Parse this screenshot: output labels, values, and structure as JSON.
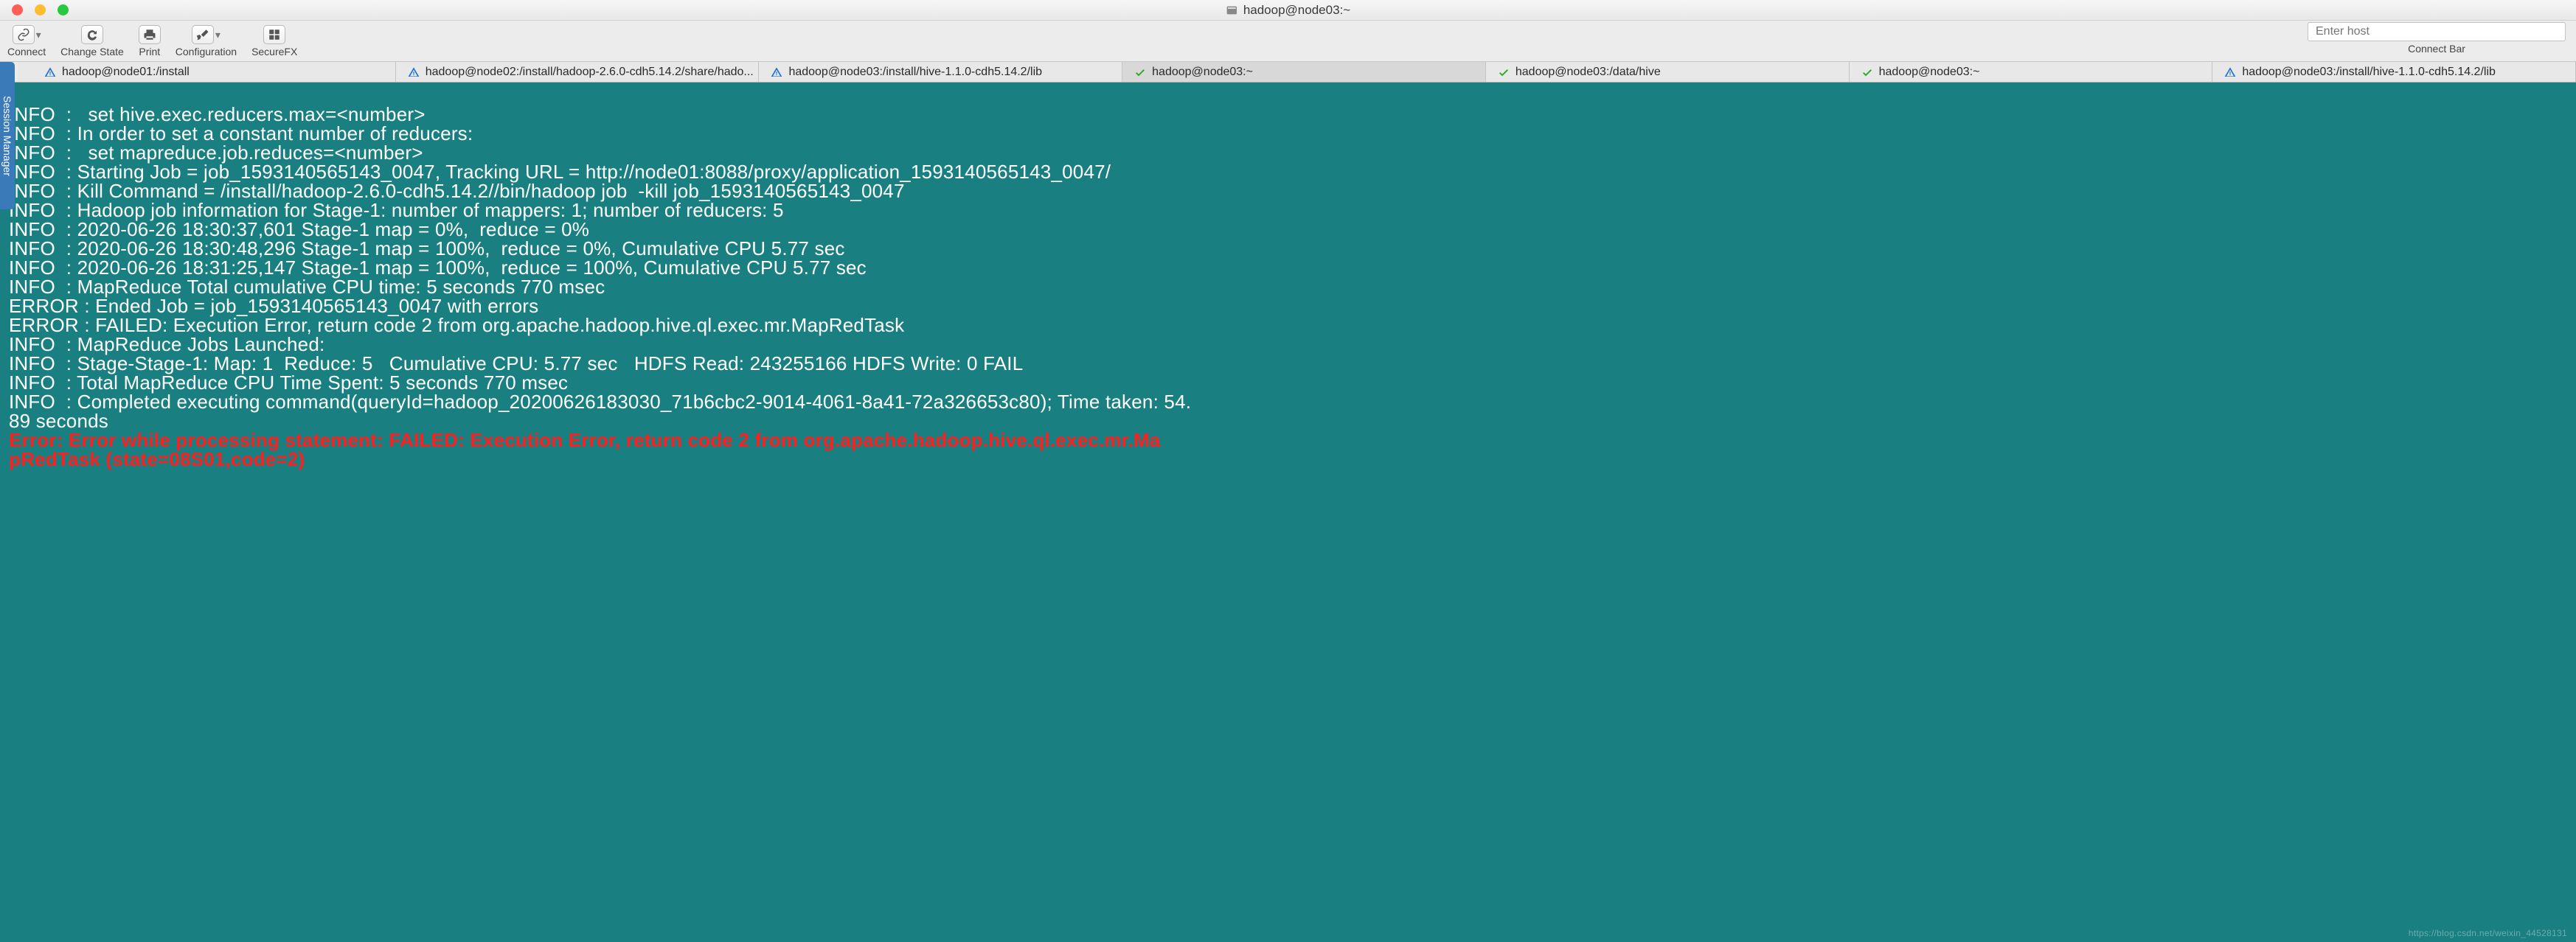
{
  "window": {
    "title": "hadoop@node03:~"
  },
  "toolbar": {
    "connect": "Connect",
    "change_state": "Change State",
    "print": "Print",
    "configuration": "Configuration",
    "securefx": "SecureFX",
    "host_placeholder": "Enter host",
    "connect_bar": "Connect Bar"
  },
  "side_tab": "Session Manager",
  "tabs": [
    {
      "icon": "warn",
      "label": "hadoop@node01:/install"
    },
    {
      "icon": "warn",
      "label": "hadoop@node02:/install/hadoop-2.6.0-cdh5.14.2/share/hado..."
    },
    {
      "icon": "warn",
      "label": "hadoop@node03:/install/hive-1.1.0-cdh5.14.2/lib"
    },
    {
      "icon": "check",
      "label": "hadoop@node03:~"
    },
    {
      "icon": "check",
      "label": "hadoop@node03:/data/hive"
    },
    {
      "icon": "check",
      "label": "hadoop@node03:~"
    },
    {
      "icon": "warn",
      "label": "hadoop@node03:/install/hive-1.1.0-cdh5.14.2/lib"
    }
  ],
  "terminal": {
    "lines": [
      "INFO  :   set hive.exec.reducers.max=<number>",
      "INFO  : In order to set a constant number of reducers:",
      "INFO  :   set mapreduce.job.reduces=<number>",
      "INFO  : Starting Job = job_1593140565143_0047, Tracking URL = http://node01:8088/proxy/application_1593140565143_0047/",
      "INFO  : Kill Command = /install/hadoop-2.6.0-cdh5.14.2//bin/hadoop job  -kill job_1593140565143_0047",
      "INFO  : Hadoop job information for Stage-1: number of mappers: 1; number of reducers: 5",
      "INFO  : 2020-06-26 18:30:37,601 Stage-1 map = 0%,  reduce = 0%",
      "INFO  : 2020-06-26 18:30:48,296 Stage-1 map = 100%,  reduce = 0%, Cumulative CPU 5.77 sec",
      "INFO  : 2020-06-26 18:31:25,147 Stage-1 map = 100%,  reduce = 100%, Cumulative CPU 5.77 sec",
      "INFO  : MapReduce Total cumulative CPU time: 5 seconds 770 msec",
      "ERROR : Ended Job = job_1593140565143_0047 with errors",
      "ERROR : FAILED: Execution Error, return code 2 from org.apache.hadoop.hive.ql.exec.mr.MapRedTask",
      "INFO  : MapReduce Jobs Launched:",
      "INFO  : Stage-Stage-1: Map: 1  Reduce: 5   Cumulative CPU: 5.77 sec   HDFS Read: 243255166 HDFS Write: 0 FAIL",
      "INFO  : Total MapReduce CPU Time Spent: 5 seconds 770 msec",
      "INFO  : Completed executing command(queryId=hadoop_20200626183030_71b6cbc2-9014-4061-8a41-72a326653c80); Time taken: 54.",
      "89 seconds"
    ],
    "error_lines": [
      "Error: Error while processing statement: FAILED: Execution Error, return code 2 from org.apache.hadoop.hive.ql.exec.mr.Ma",
      "pRedTask (state=08S01,code=2)"
    ]
  },
  "watermark": "https://blog.csdn.net/weixin_44528131"
}
